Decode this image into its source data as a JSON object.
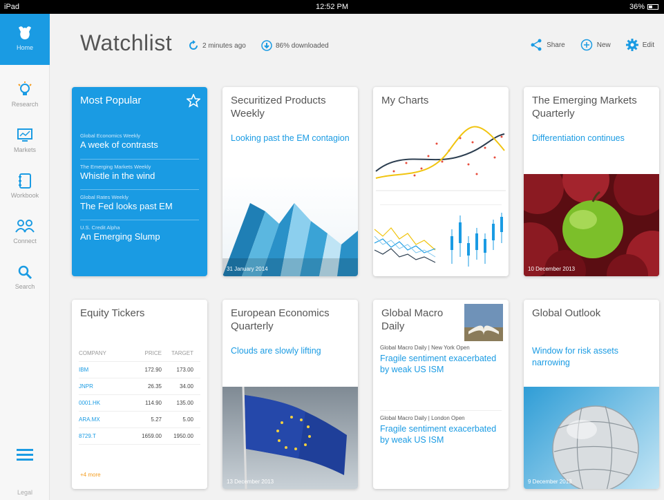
{
  "status_bar": {
    "device": "iPad",
    "time": "12:52 PM",
    "battery": "36%"
  },
  "sidebar": {
    "items": [
      {
        "label": "Home",
        "icon": "bull-logo-icon"
      },
      {
        "label": "Research",
        "icon": "lightbulb-icon"
      },
      {
        "label": "Markets",
        "icon": "monitor-chart-icon"
      },
      {
        "label": "Workbook",
        "icon": "workbook-icon"
      },
      {
        "label": "Connect",
        "icon": "people-icon"
      },
      {
        "label": "Search",
        "icon": "search-icon"
      }
    ],
    "legal": "Legal"
  },
  "header": {
    "title": "Watchlist",
    "updated": "2 minutes ago",
    "downloaded": "86% downloaded",
    "share_label": "Share",
    "new_label": "New",
    "edit_label": "Edit"
  },
  "colors": {
    "accent": "#1a9be3",
    "more": "#f39c1f"
  },
  "cards": {
    "most_popular": {
      "title": "Most Popular",
      "items": [
        {
          "series": "Global Economics Weekly",
          "headline": "A week of contrasts"
        },
        {
          "series": "The Emerging Markets Weekly",
          "headline": "Whistle in the wind"
        },
        {
          "series": "Global Rates Weekly",
          "headline": "The Fed looks past EM"
        },
        {
          "series": "U.S. Credit Alpha",
          "headline": "An Emerging Slump"
        }
      ]
    },
    "securitized": {
      "title": "Securitized Products Weekly",
      "subtitle": "Looking past the EM contagion",
      "date": "31 January 2014"
    },
    "my_charts": {
      "title": "My Charts"
    },
    "emerging": {
      "title": "The Emerging Markets Quarterly",
      "subtitle": "Differentiation continues",
      "date": "10 December 2013"
    },
    "equity": {
      "title": "Equity Tickers",
      "columns": [
        "COMPANY",
        "PRICE",
        "TARGET"
      ],
      "rows": [
        [
          "IBM",
          "172.90",
          "173.00"
        ],
        [
          "JNPR",
          "26.35",
          "34.00"
        ],
        [
          "0001.HK",
          "114.90",
          "135.00"
        ],
        [
          "ARA.MX",
          "5.27",
          "5.00"
        ],
        [
          "8729.T",
          "1659.00",
          "1950.00"
        ]
      ],
      "more": "+4 more"
    },
    "european": {
      "title": "European Economics Quarterly",
      "subtitle": "Clouds are slowly lifting",
      "date": "13 December 2013"
    },
    "global_macro": {
      "title": "Global Macro Daily",
      "items": [
        {
          "series": "Global Macro Daily | New York Open",
          "headline": "Fragile sentiment exacerbated by weak US ISM"
        },
        {
          "series": "Global Macro Daily | London Open",
          "headline": "Fragile sentiment exacerbated by weak US ISM"
        }
      ]
    },
    "global_outlook": {
      "title": "Global Outlook",
      "subtitle": "Window for risk assets narrowing",
      "date": "9 December 2013"
    }
  }
}
